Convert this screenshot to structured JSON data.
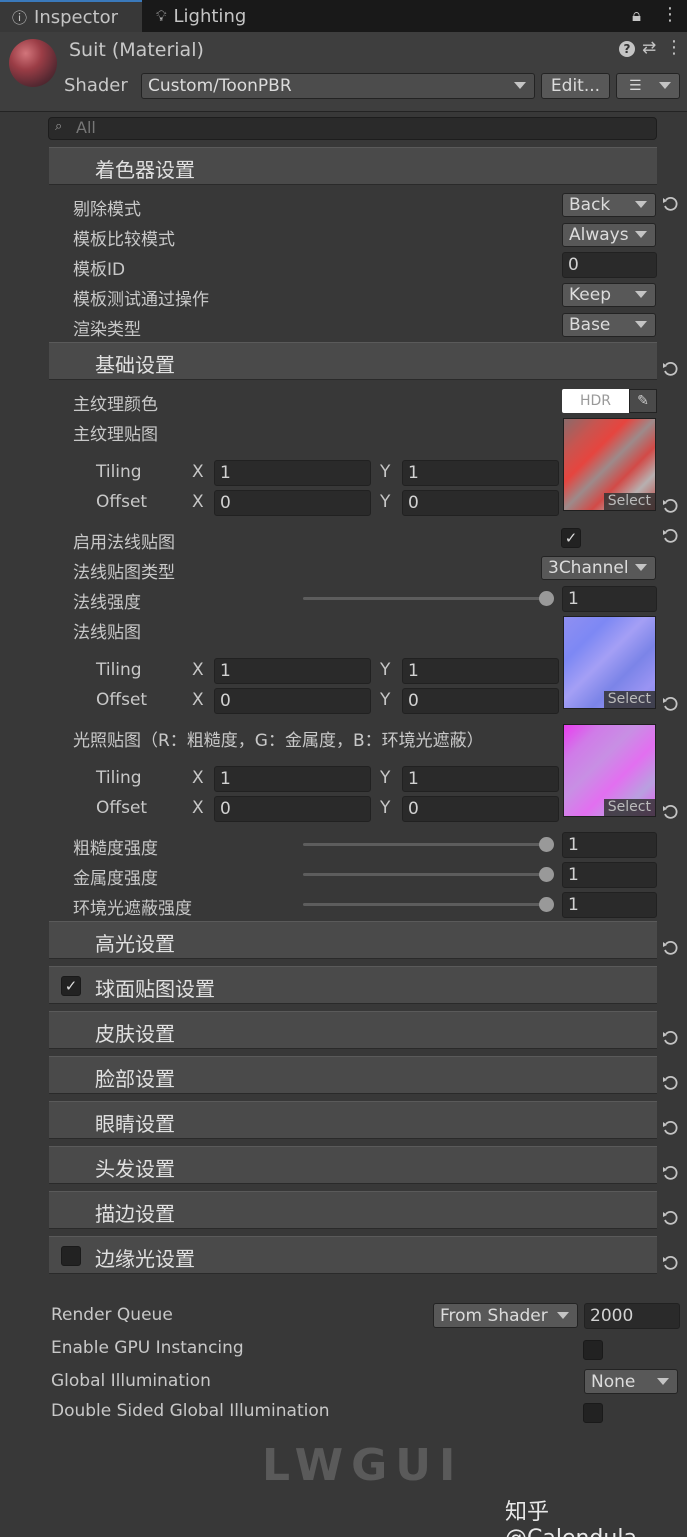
{
  "tabs": {
    "inspector": "Inspector",
    "lighting": "Lighting"
  },
  "header": {
    "material_name": "Suit (Material)",
    "shader_label": "Shader",
    "shader_value": "Custom/ToonPBR",
    "edit_button": "Edit..."
  },
  "search": {
    "placeholder": "All"
  },
  "groups": {
    "shader_settings": "着色器设置",
    "basic_settings": "基础设置",
    "specular": "高光设置",
    "sphere_map": "球面贴图设置",
    "skin": "皮肤设置",
    "face": "脸部设置",
    "eye": "眼睛设置",
    "hair": "头发设置",
    "outline": "描边设置",
    "rim": "边缘光设置"
  },
  "shader_settings": {
    "cull_label": "剔除模式",
    "cull_value": "Back",
    "stencil_comp_label": "模板比较模式",
    "stencil_comp_value": "Always",
    "stencil_id_label": "模板ID",
    "stencil_id_value": "0",
    "stencil_pass_label": "模板测试通过操作",
    "stencil_pass_value": "Keep",
    "render_type_label": "渲染类型",
    "render_type_value": "Base"
  },
  "basic": {
    "main_color_label": "主纹理颜色",
    "hdr": "HDR",
    "main_tex_label": "主纹理贴图",
    "normal_enable_label": "启用法线贴图",
    "normal_type_label": "法线贴图类型",
    "normal_type_value": "3Channel",
    "normal_strength_label": "法线强度",
    "normal_strength_value": "1",
    "normal_tex_label": "法线贴图",
    "light_tex_label": "光照贴图（R：粗糙度，G：金属度，B：环境光遮蔽）",
    "rough_label": "粗糙度强度",
    "rough_value": "1",
    "metal_label": "金属度强度",
    "metal_value": "1",
    "ao_label": "环境光遮蔽强度",
    "ao_value": "1"
  },
  "tiling": {
    "tiling": "Tiling",
    "offset": "Offset",
    "x": "X",
    "y": "Y",
    "one": "1",
    "zero": "0",
    "select": "Select"
  },
  "footer": {
    "rq_label": "Render Queue",
    "rq_mode": "From Shader",
    "rq_value": "2000",
    "gpu_label": "Enable GPU Instancing",
    "gi_label": "Global Illumination",
    "gi_value": "None",
    "dsgi_label": "Double Sided Global Illumination"
  },
  "watermark": "LWGUI",
  "credit": "知乎 @Calendula"
}
